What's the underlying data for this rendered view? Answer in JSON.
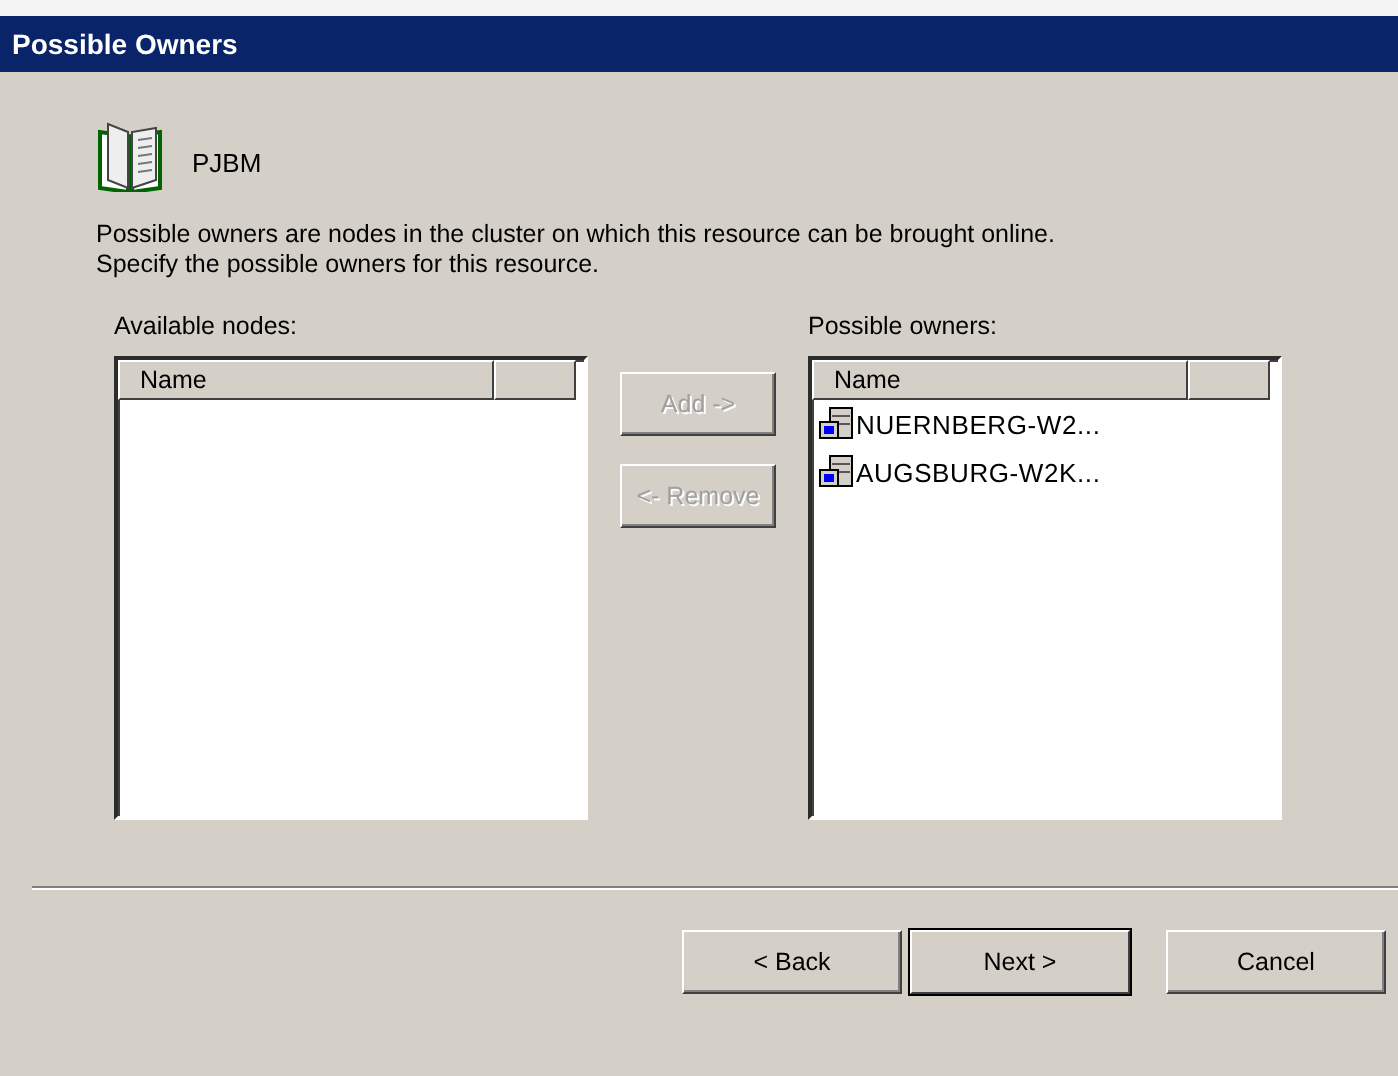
{
  "window": {
    "title": "Possible Owners"
  },
  "resource": {
    "name": "PJBM"
  },
  "description": [
    "Possible owners are nodes in the cluster on which this resource can be brought online.",
    "Specify the possible owners for this resource."
  ],
  "available_nodes": {
    "label": "Available nodes:",
    "columns": [
      "Name"
    ]
  },
  "transfer_buttons": [
    {
      "label": "Add ->",
      "disabled": true
    },
    {
      "label": "<- Remove",
      "disabled": true
    }
  ],
  "possible_owners": {
    "label": "Possible owners:",
    "columns": [
      "Name"
    ],
    "rows": [
      {
        "name": "NUERNBERG-W2..."
      },
      {
        "name": "AUGSBURG-W2K..."
      }
    ]
  },
  "buttons": [
    {
      "label": "< Back",
      "default": false
    },
    {
      "label": "Next >",
      "default": true
    },
    {
      "label": "Cancel",
      "default": false
    }
  ]
}
